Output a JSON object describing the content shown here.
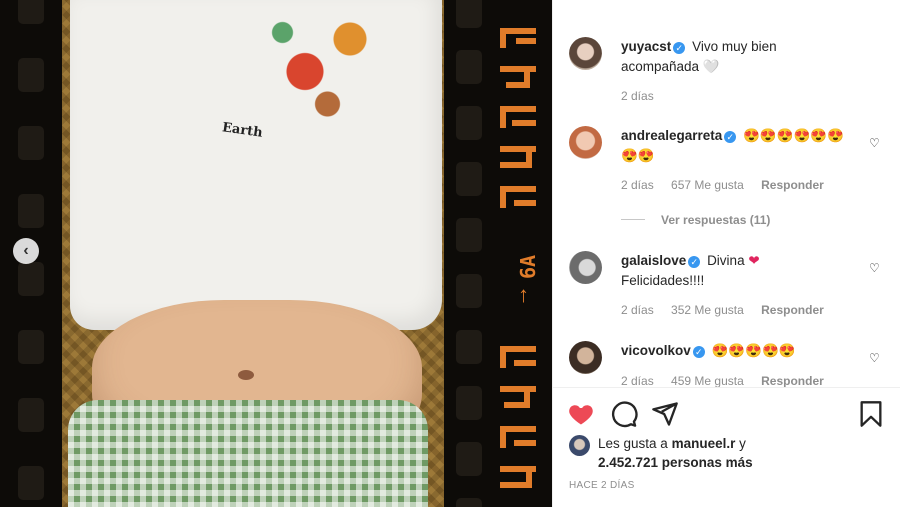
{
  "post": {
    "image_alt_icon": "chevron-left-icon",
    "film_label": "6A",
    "shirt_print_text": "Earth"
  },
  "caption": {
    "username": "yuyacst",
    "text": "Vivo muy bien acompañada 🤍",
    "time": "2 días"
  },
  "comments": [
    {
      "username": "andrealegarreta",
      "text": "😍😍😍😍😍😍😍😍",
      "time": "2 días",
      "likes": "657 Me gusta",
      "reply_label": "Responder",
      "view_replies": "Ver respuestas (11)"
    },
    {
      "username": "galaislove",
      "text_before_heart": "Divina",
      "heart": "❤",
      "text_after": "Felicidades!!!!",
      "time": "2 días",
      "likes": "352 Me gusta",
      "reply_label": "Responder"
    },
    {
      "username": "vicovolkov",
      "text": "😍😍😍😍😍",
      "time": "2 días",
      "likes": "459 Me gusta",
      "reply_label": "Responder"
    }
  ],
  "actions": {
    "like_icon": "heart-filled-icon",
    "comment_icon": "comment-icon",
    "share_icon": "share-icon",
    "save_icon": "bookmark-icon",
    "liked_color": "#ed4956"
  },
  "likes_summary": {
    "prefix": "Les gusta a",
    "user": "manueel.r",
    "connector": "y",
    "count": "2.452.721 personas más"
  },
  "posted_ago": "HACE 2 DÍAS"
}
